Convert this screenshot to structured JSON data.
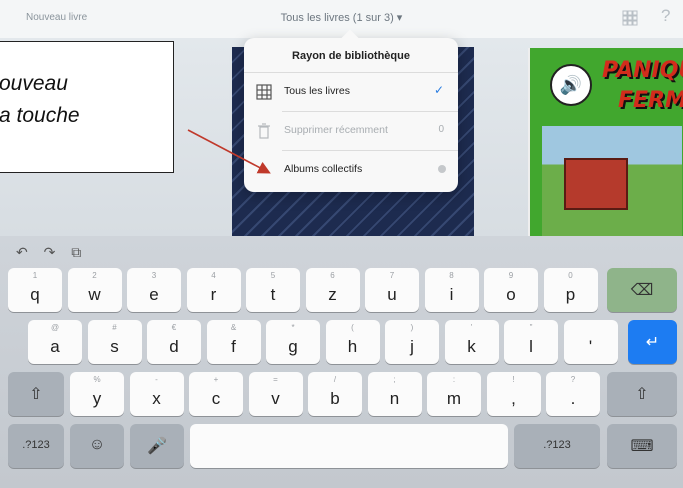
{
  "topbar": {
    "left_label": "Nouveau livre",
    "library_title": "Tous les livres (1 sur 3) ▾",
    "help": "?"
  },
  "popover": {
    "title": "Rayon de bibliothèque",
    "rows": [
      {
        "label": "Tous les livres",
        "check": "✓"
      },
      {
        "label": "Supprimer récemment",
        "count": "0"
      },
      {
        "value": "Albums collectifs"
      }
    ]
  },
  "callout": {
    "text": "ouveau\na touche"
  },
  "book_right": {
    "title_line1": "PANIQUE",
    "title_line2": "FERME"
  },
  "keyboard": {
    "toolbar": [
      "↶",
      "↷",
      "⧉"
    ],
    "row1": [
      {
        "hint": "1",
        "ch": "q"
      },
      {
        "hint": "2",
        "ch": "w"
      },
      {
        "hint": "3",
        "ch": "e"
      },
      {
        "hint": "4",
        "ch": "r"
      },
      {
        "hint": "5",
        "ch": "t"
      },
      {
        "hint": "6",
        "ch": "z"
      },
      {
        "hint": "7",
        "ch": "u"
      },
      {
        "hint": "8",
        "ch": "i"
      },
      {
        "hint": "9",
        "ch": "o"
      },
      {
        "hint": "0",
        "ch": "p"
      }
    ],
    "row2": [
      {
        "hint": "@",
        "ch": "a"
      },
      {
        "hint": "#",
        "ch": "s"
      },
      {
        "hint": "€",
        "ch": "d"
      },
      {
        "hint": "&",
        "ch": "f"
      },
      {
        "hint": "*",
        "ch": "g"
      },
      {
        "hint": "(",
        "ch": "h"
      },
      {
        "hint": ")",
        "ch": "j"
      },
      {
        "hint": "'",
        "ch": "k"
      },
      {
        "hint": "\"",
        "ch": "l"
      },
      {
        "hint": "",
        "ch": "'"
      }
    ],
    "row3": [
      {
        "hint": "%",
        "ch": "y"
      },
      {
        "hint": "-",
        "ch": "x"
      },
      {
        "hint": "+",
        "ch": "c"
      },
      {
        "hint": "=",
        "ch": "v"
      },
      {
        "hint": "/",
        "ch": "b"
      },
      {
        "hint": ";",
        "ch": "n"
      },
      {
        "hint": ":",
        "ch": "m"
      },
      {
        "hint": "!",
        "ch": ","
      },
      {
        "hint": "?",
        "ch": "."
      }
    ],
    "numbers_label": ".?123",
    "numbers_label_right": ".?123",
    "delete_icon": "⌫",
    "return_icon": "↵",
    "shift_icon": "⇧",
    "emoji_icon": "☺",
    "mic_icon": "🎤",
    "hide_keyboard_icon": "⌨"
  }
}
